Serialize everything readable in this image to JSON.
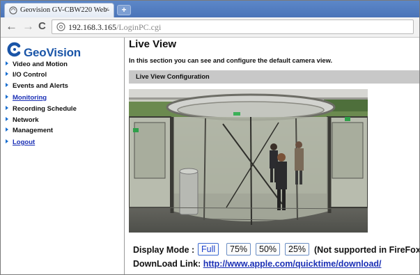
{
  "browser": {
    "tab_title": "Geovision GV-CBW220 Web-",
    "tab_close": "×",
    "new_tab": "+",
    "back": "←",
    "forward": "→",
    "reload": "C",
    "url_host": "192.168.3.165",
    "url_path": "/LoginPC.cgi"
  },
  "sidebar": {
    "logo_text": "GeoVision",
    "items": [
      {
        "label": "Video and Motion",
        "link": false
      },
      {
        "label": "I/O Control",
        "link": false
      },
      {
        "label": "Events and Alerts",
        "link": false
      },
      {
        "label": "Monitoring",
        "link": true
      },
      {
        "label": "Recording Schedule",
        "link": false
      },
      {
        "label": "Network",
        "link": false
      },
      {
        "label": "Management",
        "link": false
      },
      {
        "label": "Logout",
        "link": true
      }
    ]
  },
  "main": {
    "title": "Live View",
    "description": "In this section you can see and configure the default camera view.",
    "section_title": "Live View Configuration",
    "display_mode_label": "Display Mode :",
    "modes": [
      "Full",
      "75%",
      "50%",
      "25%"
    ],
    "active_mode": "Full",
    "mode_note": "(Not supported in FireFox)",
    "download_label": "DownLoad Link:",
    "download_url": "http://www.apple.com/quicktime/download/"
  },
  "colors": {
    "tabstrip": "#4a74b8",
    "logo_blue": "#1a55a8",
    "link_blue": "#1a2fb5",
    "section_bar": "#c8c8c8"
  }
}
